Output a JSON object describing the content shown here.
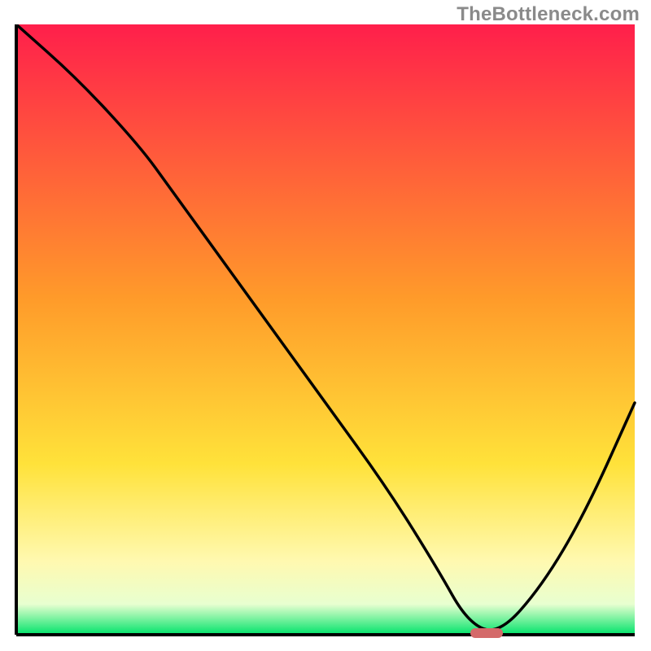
{
  "watermark": "TheBottleneck.com",
  "chart_data": {
    "type": "line",
    "title": "",
    "xlabel": "",
    "ylabel": "",
    "xlim": [
      0,
      100
    ],
    "ylim": [
      0,
      100
    ],
    "grid": false,
    "series": [
      {
        "name": "bottleneck-curve",
        "x": [
          0,
          10,
          20,
          25,
          30,
          40,
          50,
          60,
          68,
          73,
          78,
          85,
          92,
          100
        ],
        "y": [
          100,
          91,
          80,
          73,
          66,
          52,
          38,
          24,
          11,
          2,
          0,
          8,
          20,
          38
        ]
      }
    ],
    "annotations": [
      {
        "name": "optimal-marker",
        "x": 76,
        "y": 0
      }
    ],
    "background_gradient": {
      "stops": [
        {
          "offset": 0.0,
          "color": "#ff1f4b"
        },
        {
          "offset": 0.45,
          "color": "#ff9b2a"
        },
        {
          "offset": 0.72,
          "color": "#ffe23a"
        },
        {
          "offset": 0.88,
          "color": "#fff9b0"
        },
        {
          "offset": 0.95,
          "color": "#e8ffd0"
        },
        {
          "offset": 1.0,
          "color": "#00e36a"
        }
      ]
    }
  }
}
